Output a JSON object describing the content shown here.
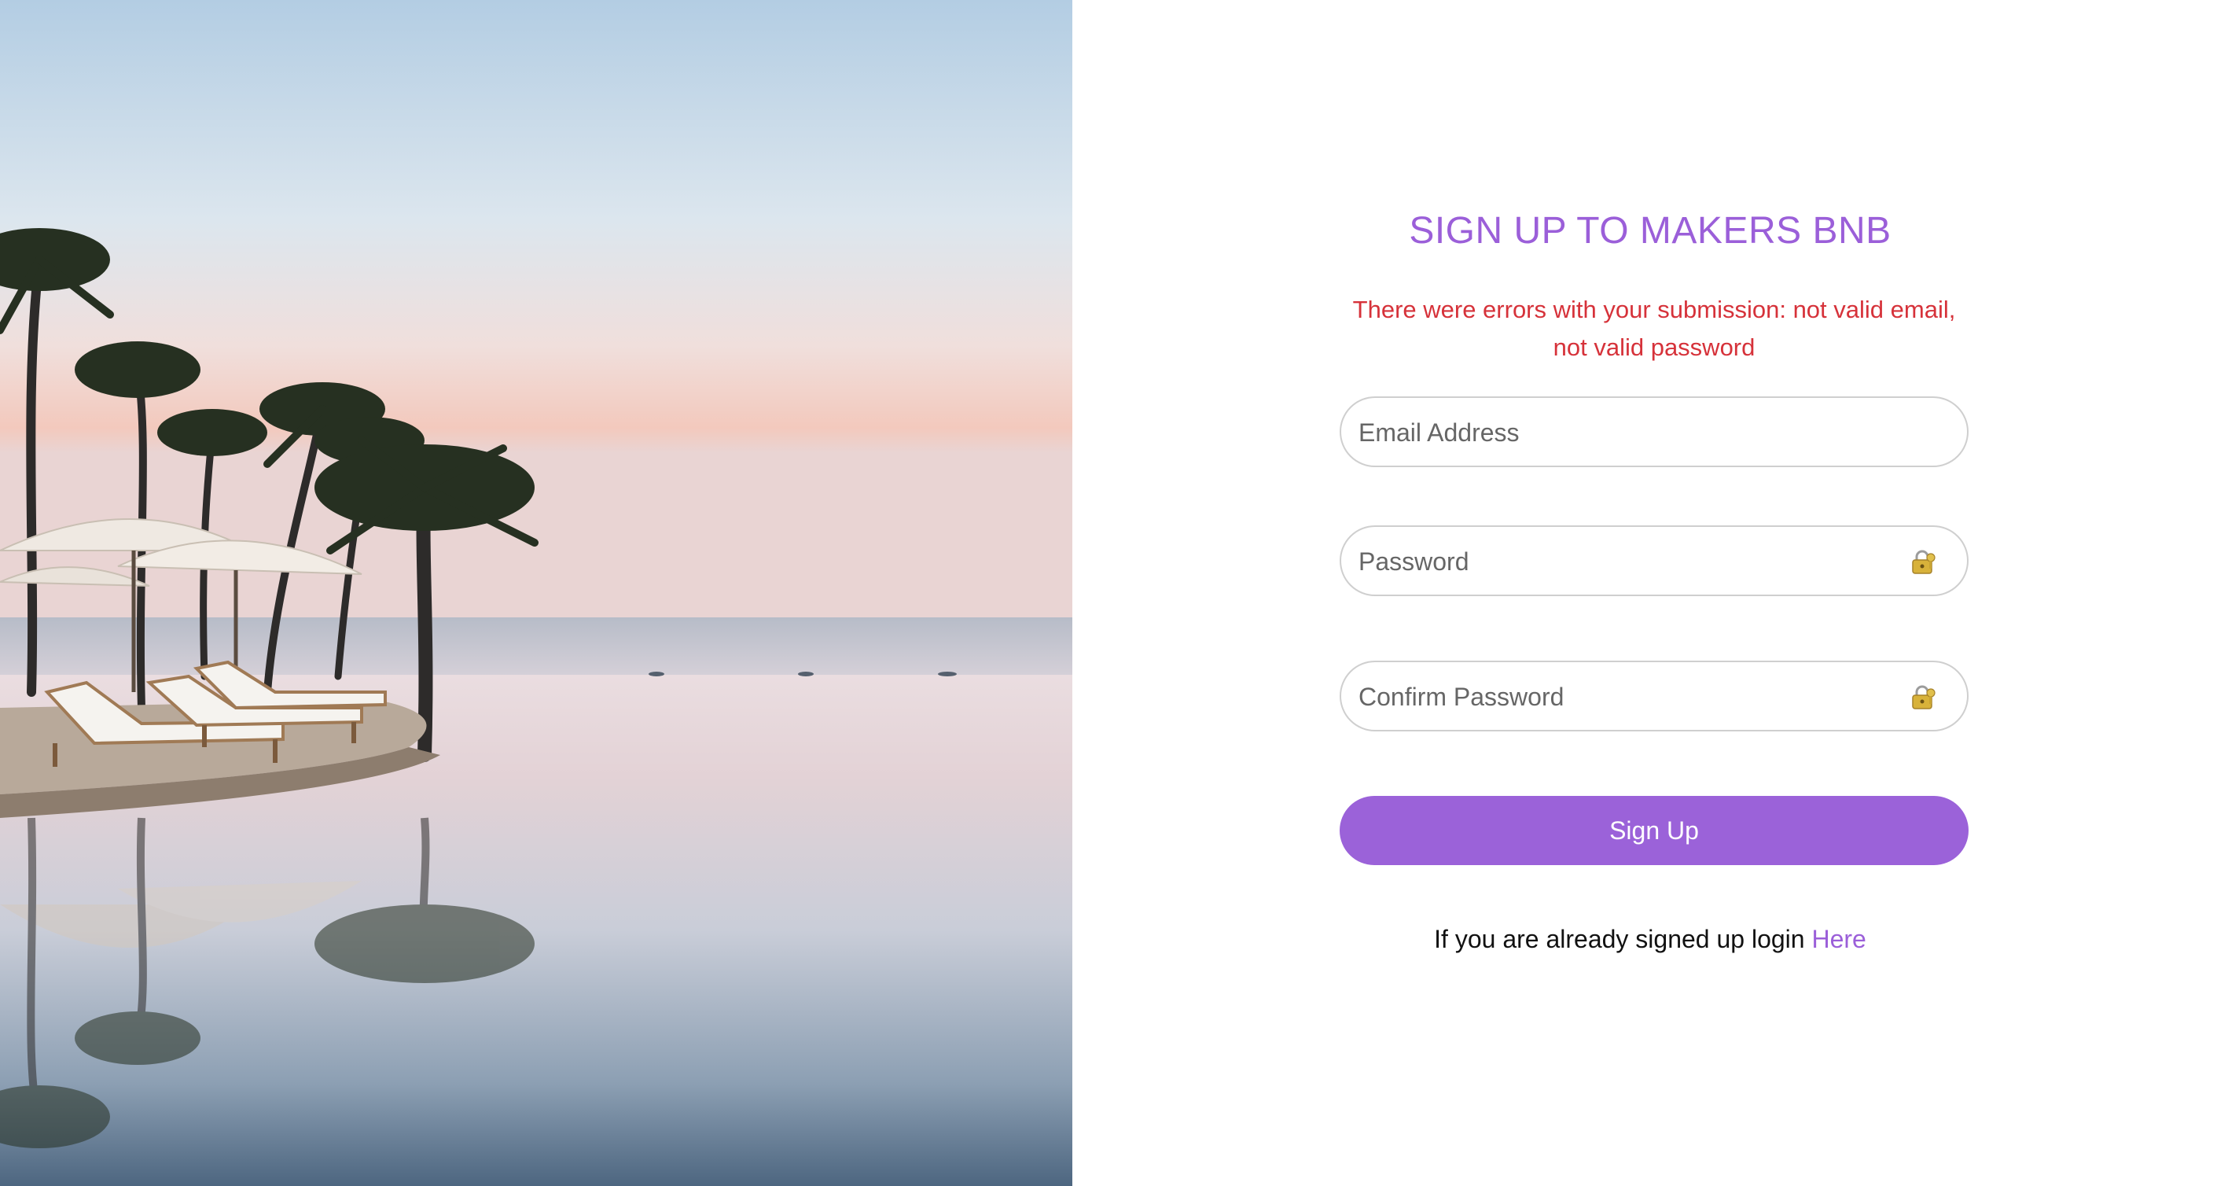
{
  "hero": {
    "image_description_icon": "resort-pool-photo"
  },
  "form": {
    "title": "SIGN UP TO MAKERS BNB",
    "error_message": "There were errors with your submission: not valid email, not valid password",
    "email_placeholder": "Email Address",
    "password_placeholder": "Password",
    "confirm_password_placeholder": "Confirm Password",
    "lock_icon": "lock-icon",
    "submit_label": "Sign Up",
    "login_prompt": "If you are already signed up login",
    "login_link_label": "Here"
  },
  "colors": {
    "accent": "#9b62d9",
    "error": "#d6323a",
    "field_border": "#cfcfcf"
  }
}
